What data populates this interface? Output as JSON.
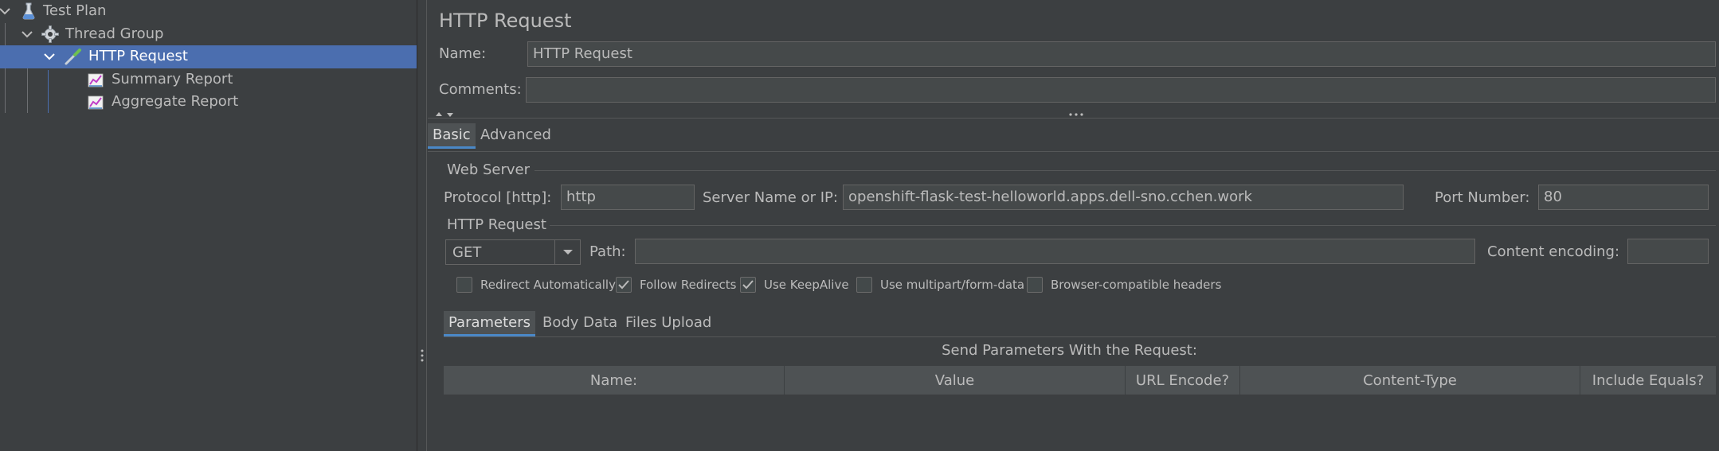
{
  "tree": {
    "items": [
      {
        "label": "Test Plan",
        "icon": "flask-icon"
      },
      {
        "label": "Thread Group",
        "icon": "gear-icon"
      },
      {
        "label": "HTTP Request",
        "icon": "pipette-icon",
        "selected": true
      },
      {
        "label": "Summary Report",
        "icon": "chart-icon"
      },
      {
        "label": "Aggregate Report",
        "icon": "chart-icon"
      }
    ]
  },
  "panel": {
    "title": "HTTP Request",
    "name_label": "Name:",
    "name_value": "HTTP Request",
    "comments_label": "Comments:",
    "comments_value": "",
    "tabs": [
      {
        "label": "Basic",
        "active": true
      },
      {
        "label": "Advanced"
      }
    ],
    "web_server": {
      "title": "Web Server",
      "protocol_label": "Protocol [http]:",
      "protocol_value": "http",
      "server_label": "Server Name or IP:",
      "server_value": "openshift-flask-test-helloworld.apps.dell-sno.cchen.work",
      "port_label": "Port Number:",
      "port_value": "80"
    },
    "http_request": {
      "title": "HTTP Request",
      "method": "GET",
      "path_label": "Path:",
      "path_value": "",
      "encoding_label": "Content encoding:",
      "encoding_value": ""
    },
    "checkboxes": [
      {
        "label": "Redirect Automatically",
        "checked": false
      },
      {
        "label": "Follow Redirects",
        "checked": true
      },
      {
        "label": "Use KeepAlive",
        "checked": true
      },
      {
        "label": "Use multipart/form-data",
        "checked": false
      },
      {
        "label": "Browser-compatible headers",
        "checked": false
      }
    ],
    "subtabs": [
      {
        "label": "Parameters",
        "active": true
      },
      {
        "label": "Body Data"
      },
      {
        "label": "Files Upload"
      }
    ],
    "params_title": "Send Parameters With the Request:",
    "columns": [
      "Name:",
      "Value",
      "URL Encode?",
      "Content-Type",
      "Include Equals?"
    ]
  },
  "colors": {
    "background": "#3c3f41",
    "selection": "#4b6eaf",
    "field": "#45494a",
    "tab_accent": "#4a88c7"
  }
}
